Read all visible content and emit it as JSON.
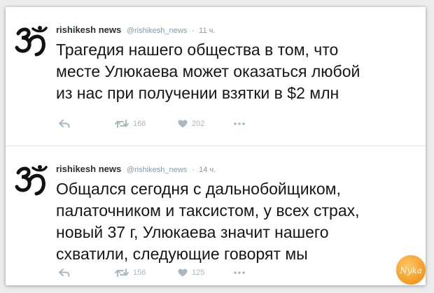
{
  "tweets": [
    {
      "name": "rishikesh news",
      "handle": "@rishikesh_news",
      "separator": "·",
      "time": "11 ч.",
      "lines": [
        "Трагедия нашего общества в том, что",
        "месте Улюкаева может оказаться любой",
        "из нас при получении взятки в $2 млн"
      ],
      "retweets": "166",
      "likes": "202"
    },
    {
      "name": "rishikesh news",
      "handle": "@rishikesh_news",
      "separator": "·",
      "time": "14 ч.",
      "lines": [
        "Общался сегодня с дальнобойщиком,",
        "палаточником и таксистом, у всех страх,",
        "новый 37 г, Улюкаева значит нашего",
        "схватили, следующие говорят мы"
      ],
      "retweets": "156",
      "likes": "125"
    }
  ],
  "icons": {
    "avatar": "om-symbol-icon",
    "reply": "reply-arrow-icon",
    "retweet": "retweet-icon",
    "like": "heart-icon",
    "more": "more-dots-icon"
  },
  "colors": {
    "icon_gray": "#aab8c2",
    "text": "#14171a",
    "meta": "#8899a6",
    "watermark_orange": "#f39a1f"
  },
  "watermark": {
    "text": "Nyka"
  }
}
